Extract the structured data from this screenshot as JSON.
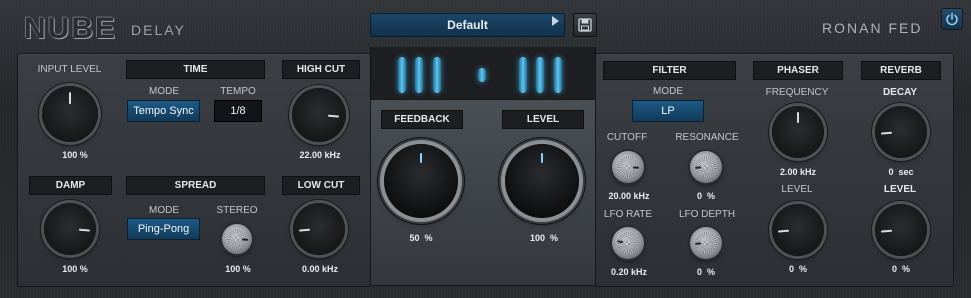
{
  "header": {
    "brand": "NUBE",
    "brand_sub": "DELAY",
    "maker": "RONAN FED",
    "preset_name": "Default",
    "prev_icon": "triangle-left-icon",
    "next_icon": "triangle-right-icon",
    "save_icon": "floppy-disk-icon",
    "power_icon": "power-icon"
  },
  "colors": {
    "accent": "#1d5a86",
    "indicator": "#7fd3ff",
    "panel": "#34383d"
  },
  "left": {
    "input_level": {
      "label": "INPUT LEVEL",
      "value": "100 %",
      "knob": 0.5
    },
    "time": {
      "header": "TIME",
      "mode_label": "MODE",
      "mode_value": "Tempo Sync",
      "tempo_label": "TEMPO",
      "tempo_value": "1/8"
    },
    "high_cut": {
      "label": "HIGH CUT",
      "value": "22.00 kHz",
      "knob": 0.85
    },
    "damp": {
      "label": "DAMP",
      "value": "100 %",
      "knob": 0.85
    },
    "spread": {
      "header": "SPREAD",
      "mode_label": "MODE",
      "mode_value": "Ping-Pong",
      "stereo_label": "STEREO",
      "stereo_value": "100 %",
      "stereo_knob": 0.85
    },
    "low_cut": {
      "label": "LOW CUT",
      "value": "0.00 kHz",
      "knob": 0.15
    }
  },
  "center": {
    "feedback": {
      "label": "FEEDBACK",
      "value_num": "50",
      "unit": "%",
      "knob": 0.5
    },
    "level": {
      "label": "LEVEL",
      "value_num": "100",
      "unit": "%",
      "knob": 0.5
    }
  },
  "right": {
    "filter": {
      "header": "FILTER",
      "mode_label": "MODE",
      "mode_value": "LP",
      "cutoff": {
        "label": "CUTOFF",
        "value": "20.00 kHz",
        "knob": 0.85
      },
      "resonance": {
        "label": "RESONANCE",
        "value_num": "0",
        "unit": "%",
        "knob": 0.15
      },
      "lfo_rate": {
        "label": "LFO RATE",
        "value": "0.20 kHz",
        "knob": 0.2
      },
      "lfo_depth": {
        "label": "LFO DEPTH",
        "value_num": "0",
        "unit": "%",
        "knob": 0.15
      }
    },
    "phaser": {
      "header": "PHASER",
      "frequency": {
        "label": "FREQUENCY",
        "value": "2.00 kHz",
        "knob": 0.5
      },
      "level": {
        "label": "LEVEL",
        "value_num": "0",
        "unit": "%",
        "knob": 0.15
      }
    },
    "reverb": {
      "header": "REVERB",
      "decay": {
        "label": "DECAY",
        "value_num": "0",
        "unit": "sec",
        "knob": 0.15
      },
      "level": {
        "label": "LEVEL",
        "value_num": "0",
        "unit": "%",
        "knob": 0.15
      }
    }
  }
}
